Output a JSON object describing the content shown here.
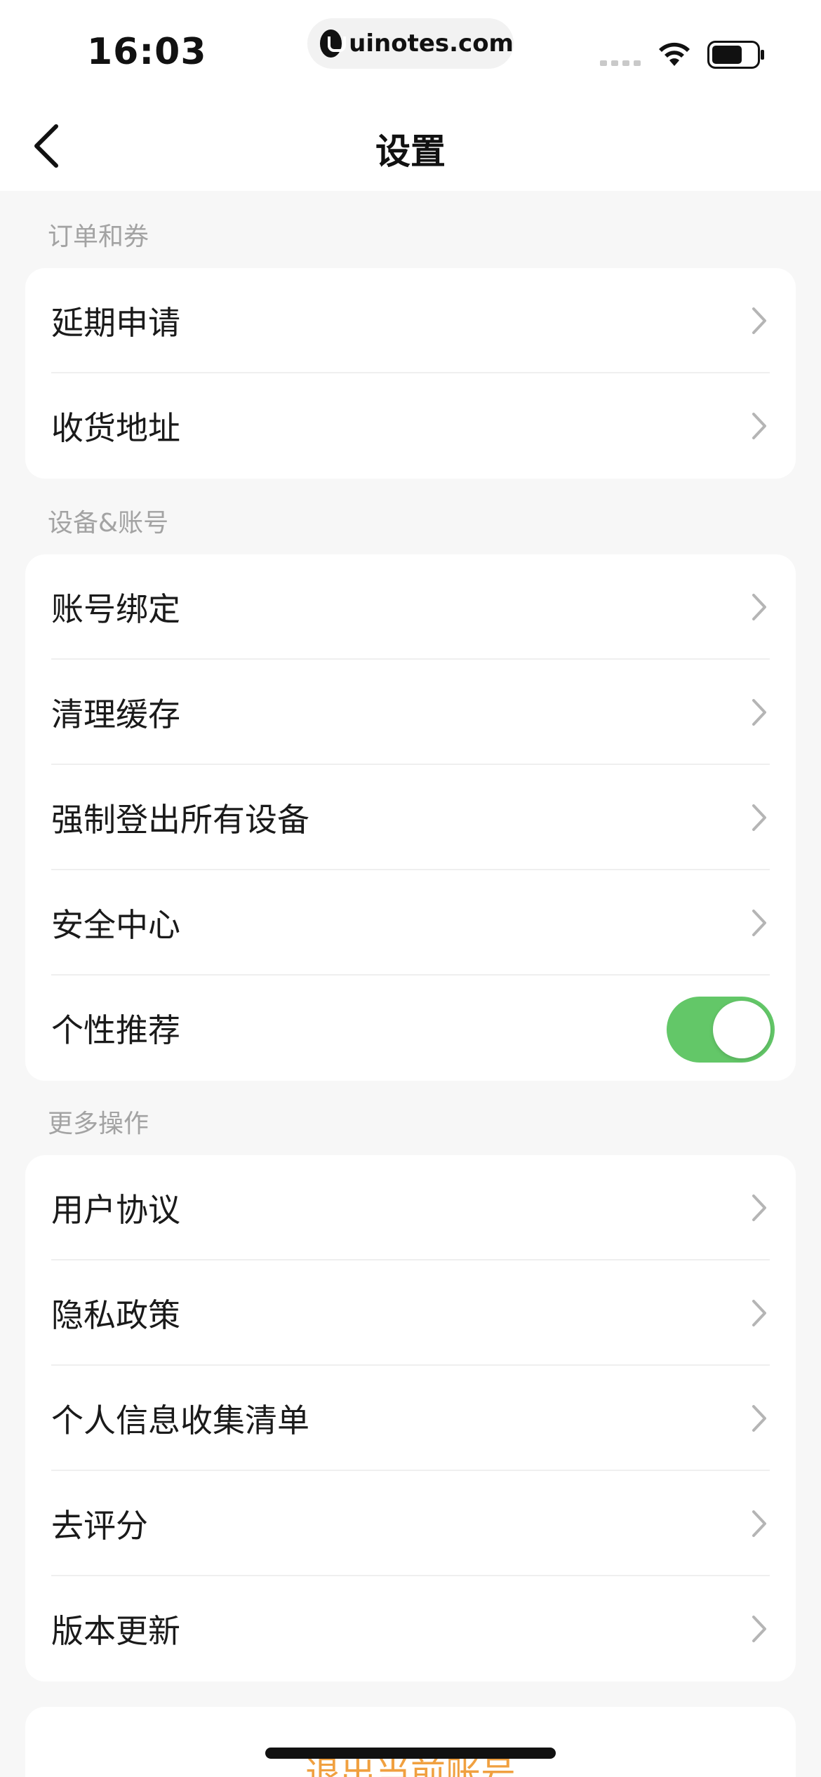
{
  "status_bar": {
    "time": "16:03",
    "url": "uinotes.com"
  },
  "nav": {
    "title": "设置"
  },
  "sections": [
    {
      "label": "订单和券",
      "items": [
        {
          "label": "延期申请"
        },
        {
          "label": "收货地址"
        }
      ]
    },
    {
      "label": "设备&账号",
      "items": [
        {
          "label": "账号绑定"
        },
        {
          "label": "清理缓存"
        },
        {
          "label": "强制登出所有设备"
        },
        {
          "label": "安全中心"
        },
        {
          "label": "个性推荐",
          "toggle_on": true
        }
      ]
    },
    {
      "label": "更多操作",
      "items": [
        {
          "label": "用户协议"
        },
        {
          "label": "隐私政策"
        },
        {
          "label": "个人信息收集清单"
        },
        {
          "label": "去评分"
        },
        {
          "label": "版本更新"
        }
      ]
    }
  ],
  "logout": {
    "label": "退出当前账号"
  },
  "colors": {
    "toggle_on": "#63c768",
    "logout_text": "#f0a040",
    "section_label": "#a3a3a3"
  }
}
